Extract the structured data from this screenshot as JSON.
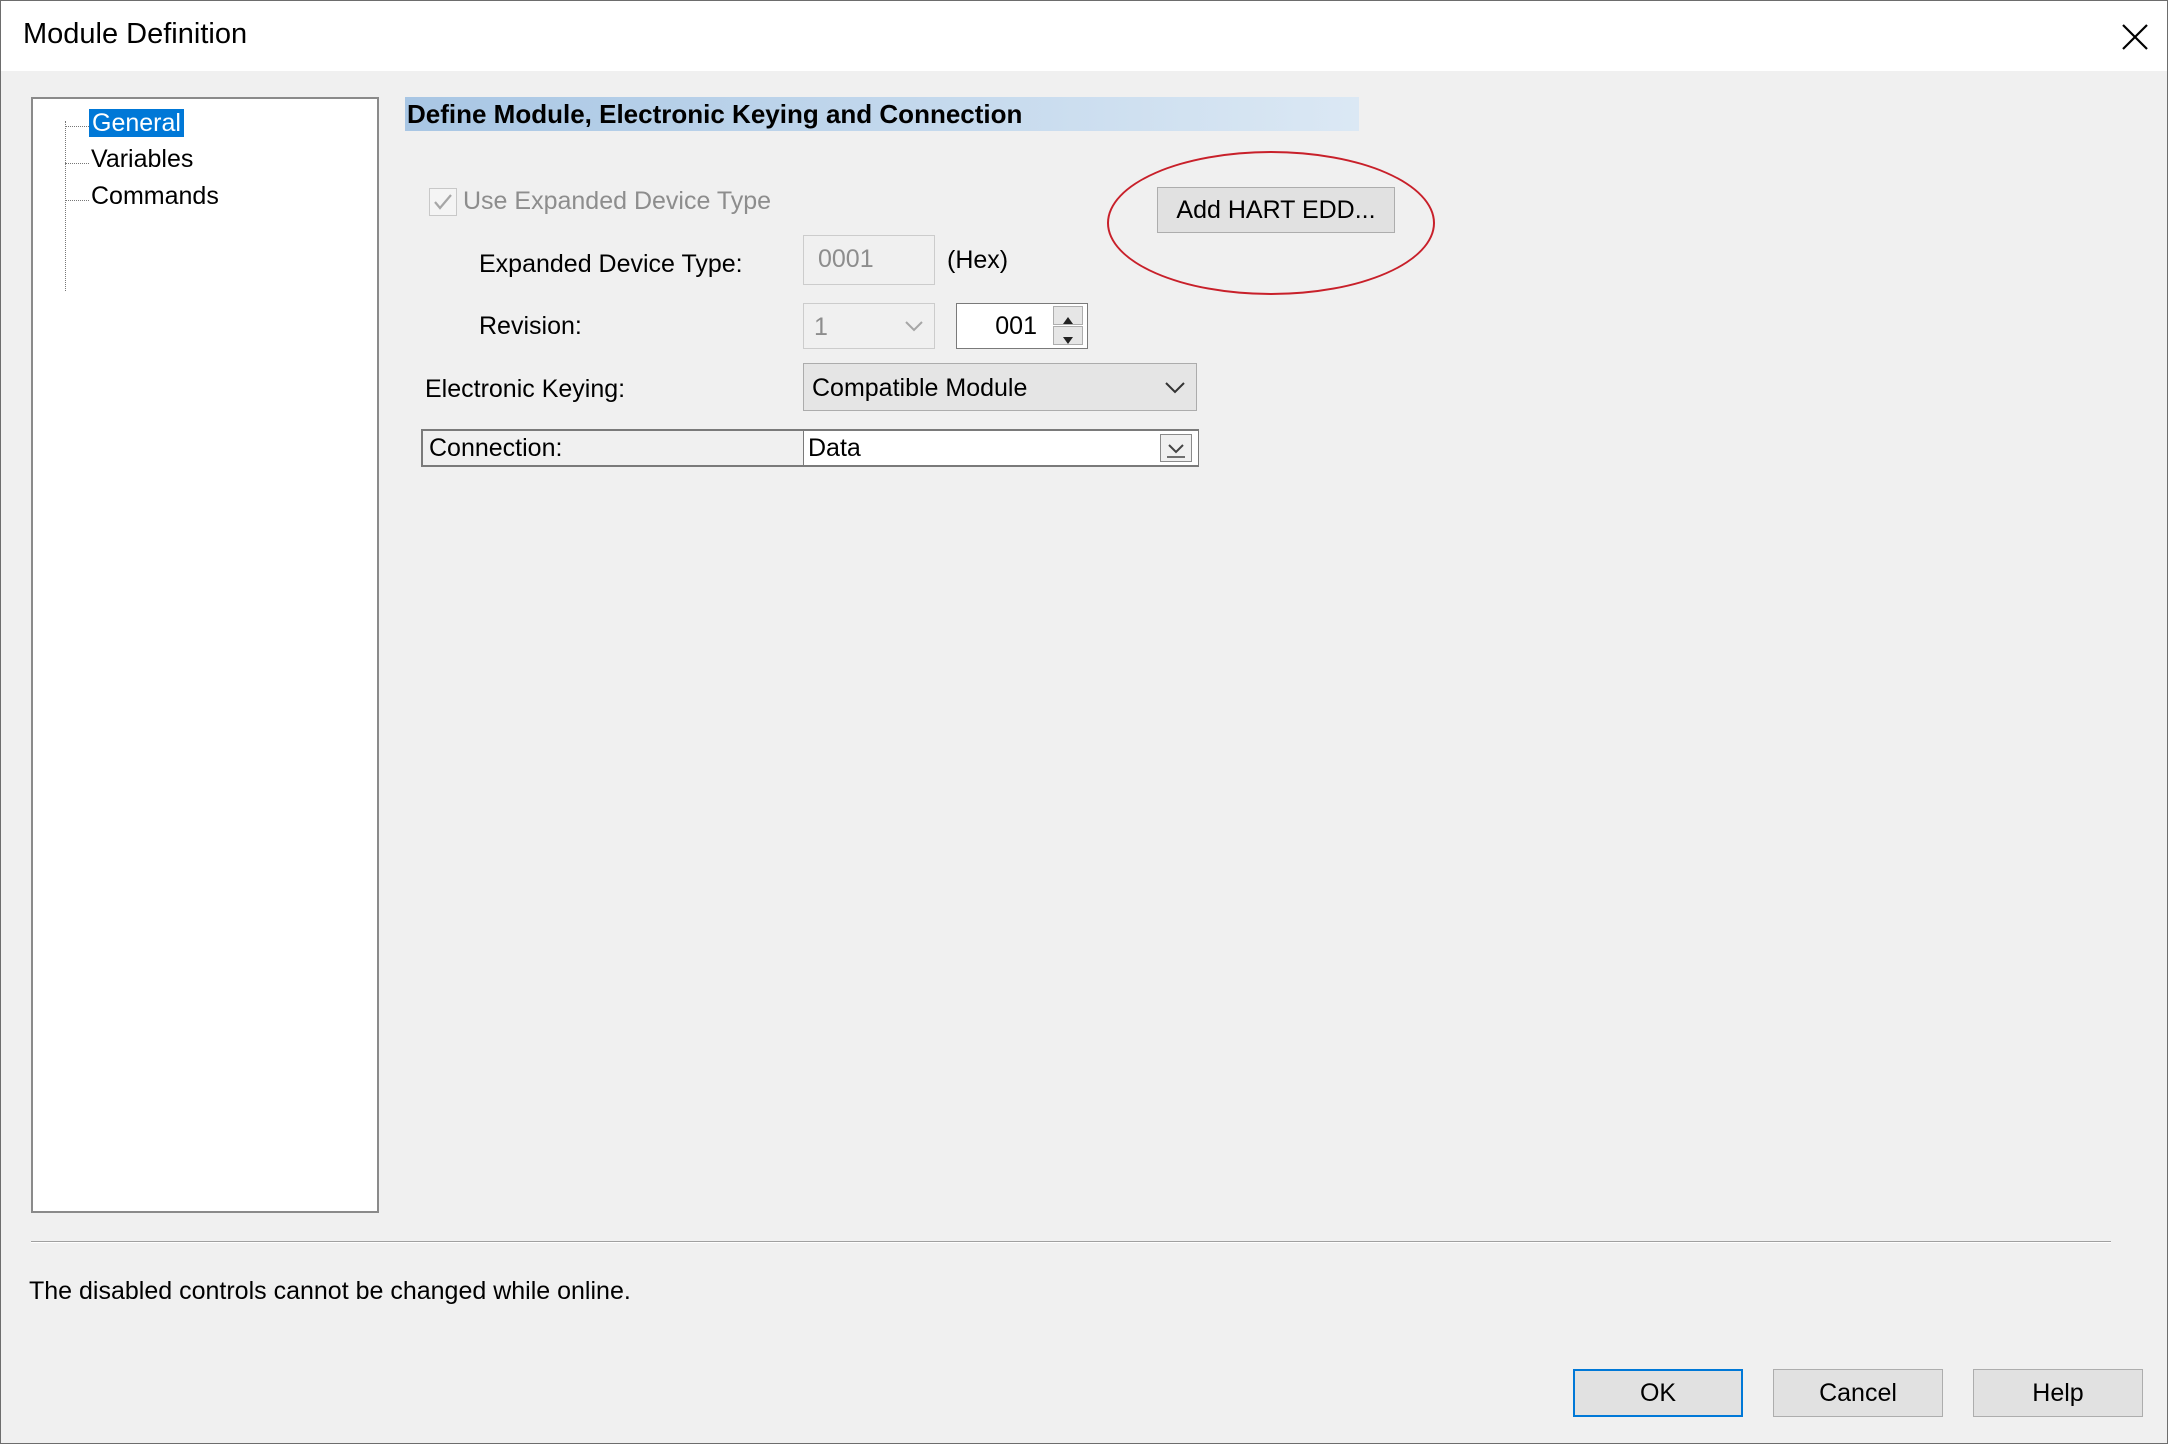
{
  "window": {
    "title": "Module Definition"
  },
  "tree": {
    "items": [
      "General",
      "Variables",
      "Commands"
    ],
    "selected_index": 0
  },
  "section": {
    "header": "Define Module, Electronic Keying and Connection"
  },
  "form": {
    "use_expanded_label": "Use Expanded Device Type",
    "use_expanded_checked": true,
    "expanded_type_label": "Expanded Device Type:",
    "expanded_type_value": "0001",
    "hex_label": "(Hex)",
    "revision_label": "Revision:",
    "revision_major": "1",
    "revision_minor": "001",
    "keying_label": "Electronic Keying:",
    "keying_value": "Compatible Module",
    "connection_label": "Connection:",
    "connection_value": "Data"
  },
  "add_hart_label": "Add HART EDD...",
  "status_message": "The disabled controls cannot be changed while online.",
  "buttons": {
    "ok": "OK",
    "cancel": "Cancel",
    "help": "Help"
  },
  "colors": {
    "selection": "#0078d7",
    "header_gradient_start": "#a8c6e4",
    "highlight_circle": "#c8202a",
    "default_button_border": "#0078d7"
  }
}
